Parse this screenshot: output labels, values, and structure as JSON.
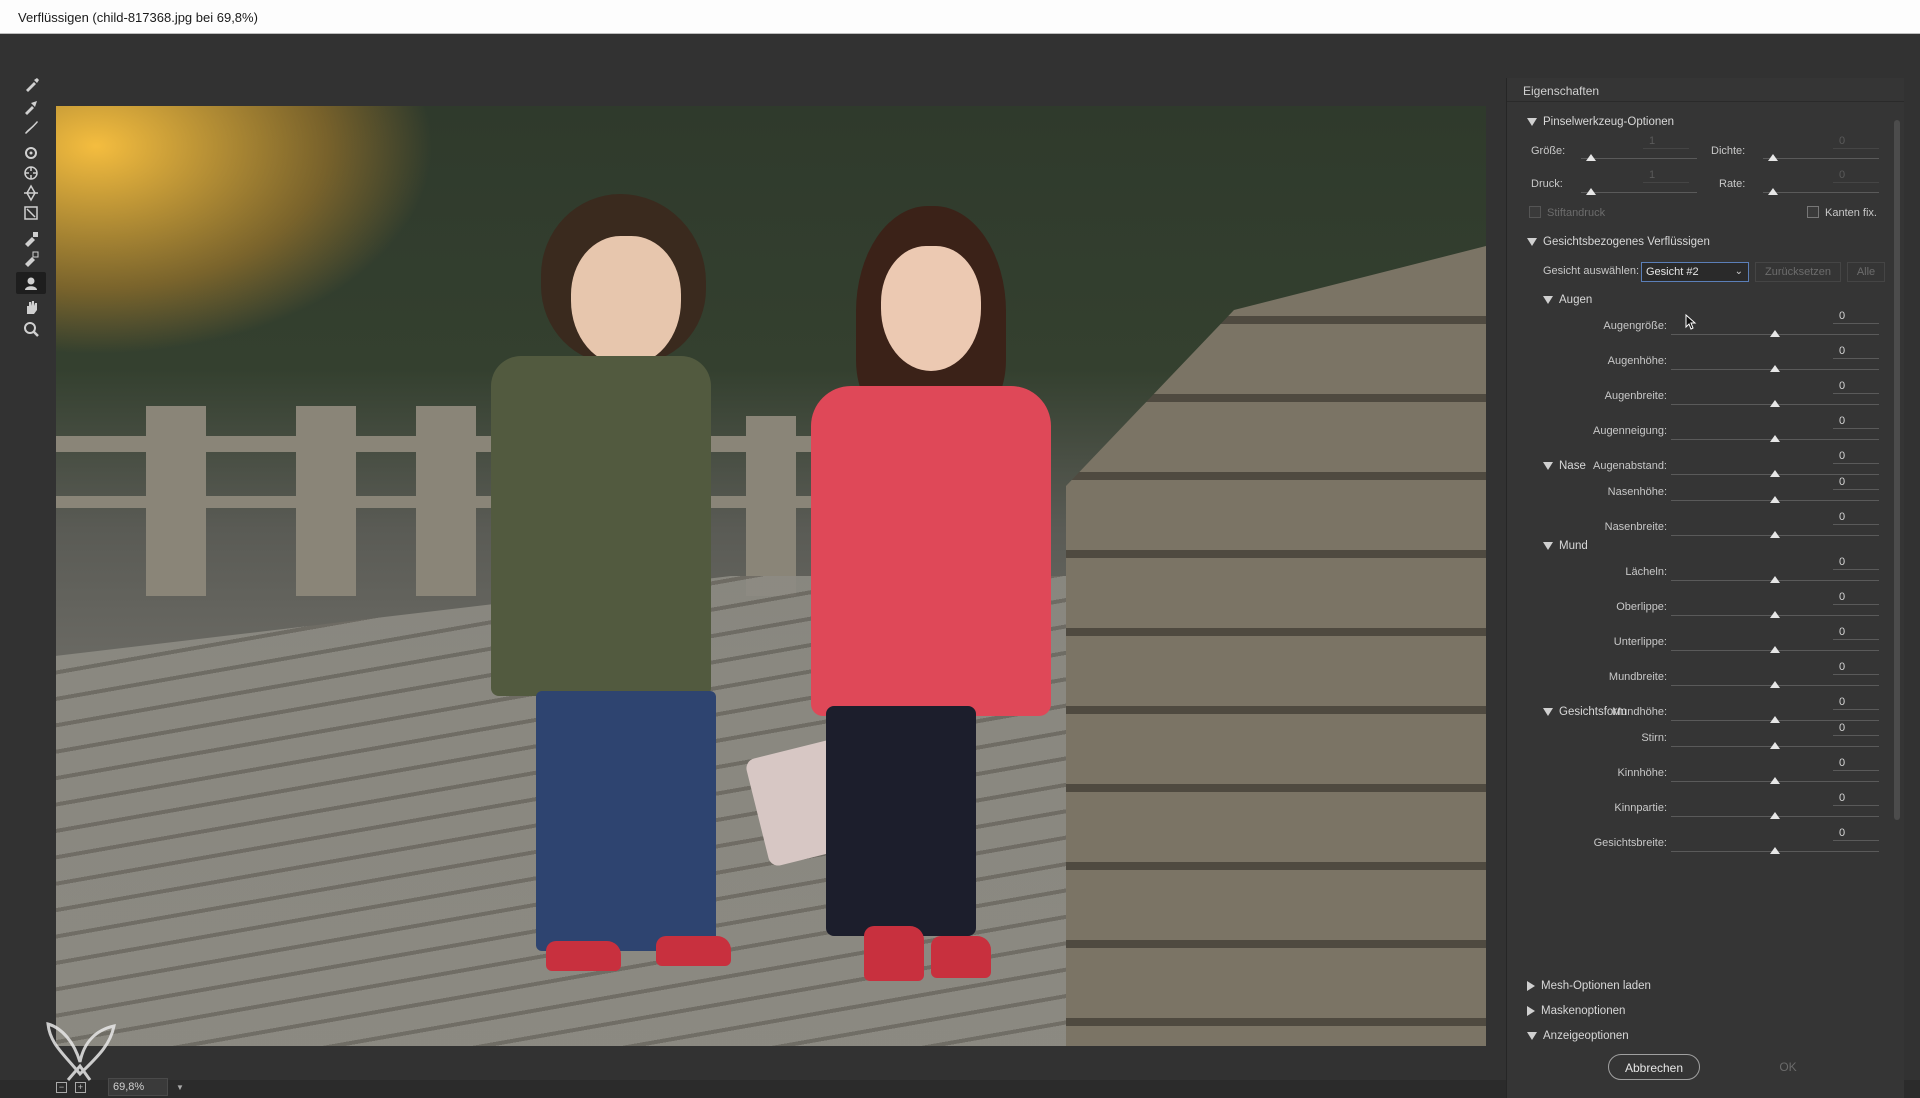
{
  "window": {
    "title": "Verflüssigen (child-817368.jpg bei 69,8%)"
  },
  "tools": [
    {
      "name": "forward-warp-tool-icon"
    },
    {
      "name": "reconstruct-tool-icon"
    },
    {
      "name": "smooth-tool-icon"
    },
    {
      "name": "twirl-tool-icon"
    },
    {
      "name": "pucker-tool-icon"
    },
    {
      "name": "bloat-tool-icon"
    },
    {
      "name": "push-left-tool-icon"
    },
    {
      "name": "freeze-mask-tool-icon"
    },
    {
      "name": "thaw-mask-tool-icon"
    },
    {
      "name": "face-tool-icon"
    },
    {
      "name": "hand-tool-icon"
    },
    {
      "name": "zoom-tool-icon"
    }
  ],
  "status": {
    "zoom": "69,8%"
  },
  "panel": {
    "header": "Eigenschaften",
    "brush": {
      "title": "Pinselwerkzeug-Optionen",
      "groesse_label": "Größe:",
      "groesse_value": "1",
      "dichte_label": "Dichte:",
      "dichte_value": "0",
      "druck_label": "Druck:",
      "druck_value": "1",
      "rate_label": "Rate:",
      "rate_value": "0",
      "stiftandruck": "Stiftandruck",
      "kanten": "Kanten fix."
    },
    "face": {
      "title": "Gesichtsbezogenes Verflüssigen",
      "select_label": "Gesicht auswählen:",
      "select_value": "Gesicht #2",
      "reset": "Zurücksetzen",
      "all": "Alle"
    },
    "groups": [
      {
        "title": "Augen",
        "sliders": [
          {
            "label": "Augengröße:",
            "value": "0"
          },
          {
            "label": "Augenhöhe:",
            "value": "0"
          },
          {
            "label": "Augenbreite:",
            "value": "0"
          },
          {
            "label": "Augenneigung:",
            "value": "0"
          },
          {
            "label": "Augenabstand:",
            "value": "0"
          }
        ]
      },
      {
        "title": "Nase",
        "sliders": [
          {
            "label": "Nasenhöhe:",
            "value": "0"
          },
          {
            "label": "Nasenbreite:",
            "value": "0"
          }
        ]
      },
      {
        "title": "Mund",
        "sliders": [
          {
            "label": "Lächeln:",
            "value": "0"
          },
          {
            "label": "Oberlippe:",
            "value": "0"
          },
          {
            "label": "Unterlippe:",
            "value": "0"
          },
          {
            "label": "Mundbreite:",
            "value": "0"
          },
          {
            "label": "Mundhöhe:",
            "value": "0"
          }
        ]
      },
      {
        "title": "Gesichtsform",
        "sliders": [
          {
            "label": "Stirn:",
            "value": "0"
          },
          {
            "label": "Kinnhöhe:",
            "value": "0"
          },
          {
            "label": "Kinnpartie:",
            "value": "0"
          },
          {
            "label": "Gesichtsbreite:",
            "value": "0"
          }
        ]
      }
    ],
    "collapsed": {
      "mesh": "Mesh-Optionen laden",
      "mask": "Maskenoptionen",
      "view": "Anzeigeoptionen"
    },
    "buttons": {
      "cancel": "Abbrechen",
      "ok": "OK"
    }
  }
}
